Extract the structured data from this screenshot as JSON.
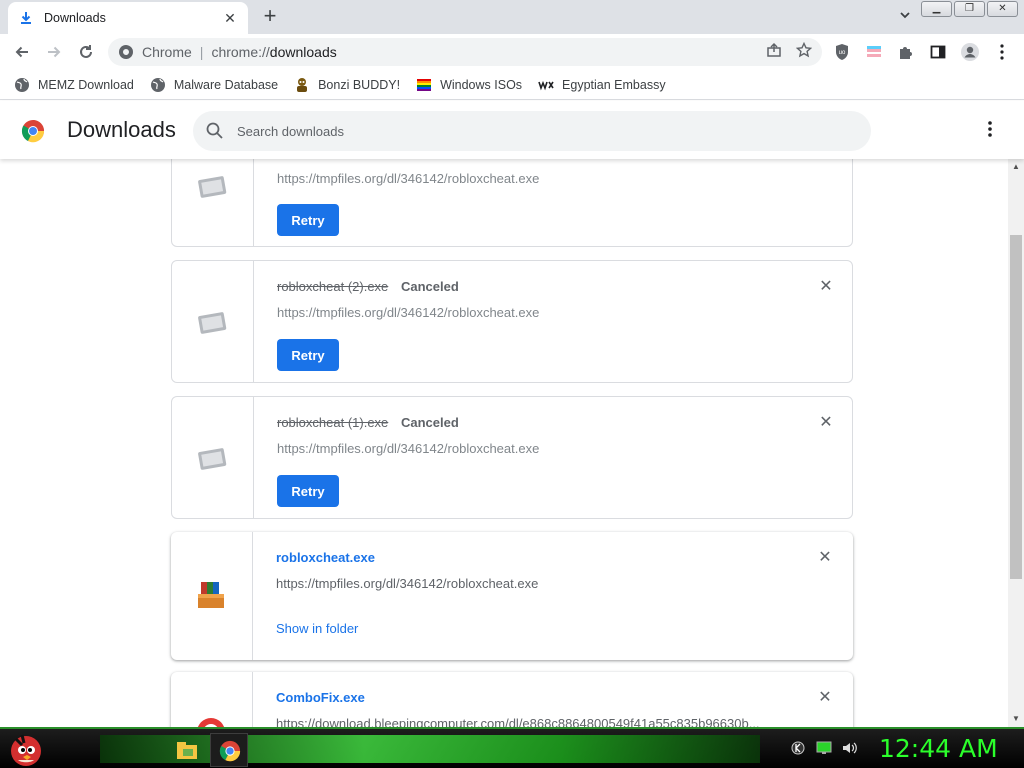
{
  "tab": {
    "title": "Downloads",
    "close": "✕"
  },
  "newtab": "+",
  "window": {
    "minimize": "▁",
    "maximize": "❐",
    "close": "✕"
  },
  "omnibox": {
    "scheme": "Chrome",
    "url_prefix": "chrome://",
    "url_rest": "downloads"
  },
  "bookmarks": [
    {
      "label": "MEMZ Download",
      "icon": "globe-icon"
    },
    {
      "label": "Malware Database",
      "icon": "globe-icon"
    },
    {
      "label": "Bonzi BUDDY!",
      "icon": "bonzi-icon"
    },
    {
      "label": "Windows ISOs",
      "icon": "windows-flag-icon"
    },
    {
      "label": "Egyptian Embassy",
      "icon": "wix-icon"
    }
  ],
  "page": {
    "title": "Downloads",
    "search_placeholder": "Search downloads"
  },
  "downloads": [
    {
      "name": "",
      "status": "",
      "url": "https://tmpfiles.org/dl/346142/robloxcheat.exe",
      "action": "Retry"
    },
    {
      "name": "robloxcheat (2).exe",
      "status": "Canceled",
      "url": "https://tmpfiles.org/dl/346142/robloxcheat.exe",
      "action": "Retry"
    },
    {
      "name": "robloxcheat (1).exe",
      "status": "Canceled",
      "url": "https://tmpfiles.org/dl/346142/robloxcheat.exe",
      "action": "Retry"
    },
    {
      "name": "robloxcheat.exe",
      "status": "",
      "url": "https://tmpfiles.org/dl/346142/robloxcheat.exe",
      "action": "Show in folder"
    },
    {
      "name": "ComboFix.exe",
      "status": "",
      "url": "https://download.bleepingcomputer.com/dl/e868c8864800549f41a55c835b96630b...",
      "action": ""
    }
  ],
  "taskbar": {
    "clock": "12:44 AM"
  },
  "colors": {
    "accent": "#1a73e8",
    "clock": "#2bff2b",
    "taskbar_glow": "#41d641"
  }
}
